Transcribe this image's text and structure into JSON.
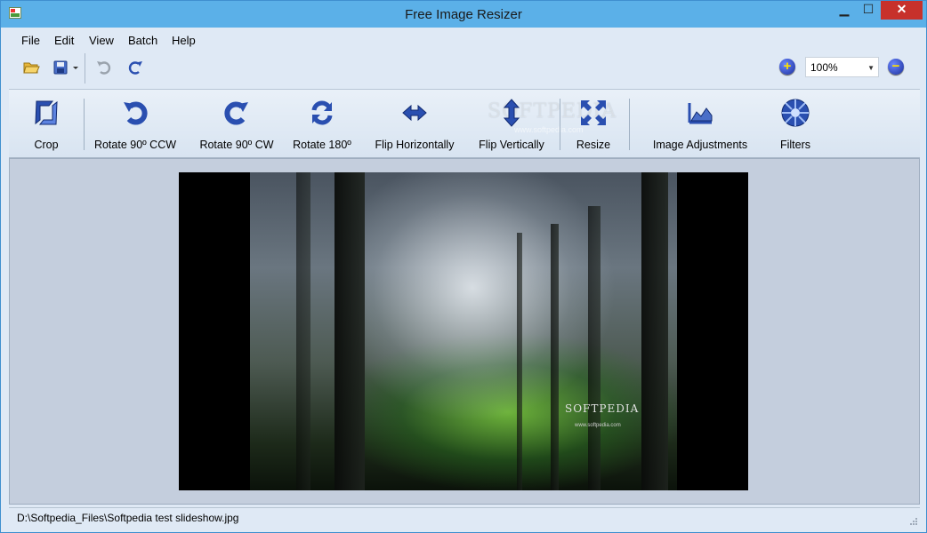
{
  "window": {
    "title": "Free Image Resizer",
    "min_glyph": "▁",
    "max_glyph": "☐",
    "close_glyph": "✕"
  },
  "menu": [
    "File",
    "Edit",
    "View",
    "Batch",
    "Help"
  ],
  "quick": {
    "zoom_value": "100%",
    "zoom_in_glyph": "+",
    "zoom_out_glyph": "−"
  },
  "toolbar": [
    {
      "label": "Crop",
      "icon": "crop-icon"
    },
    {
      "label": "Rotate 90º CCW",
      "icon": "rotate-ccw-icon"
    },
    {
      "label": "Rotate 90º CW",
      "icon": "rotate-cw-icon"
    },
    {
      "label": "Rotate 180º",
      "icon": "rotate-180-icon"
    },
    {
      "label": "Flip Horizontally",
      "icon": "flip-horizontal-icon"
    },
    {
      "label": "Flip Vertically",
      "icon": "flip-vertical-icon"
    },
    {
      "label": "Resize",
      "icon": "resize-icon"
    },
    {
      "label": "Image Adjustments",
      "icon": "image-adjustments-icon"
    },
    {
      "label": "Filters",
      "icon": "filters-icon"
    }
  ],
  "watermark": {
    "text": "SOFTPEDIA",
    "url": "www.softpedia.com"
  },
  "photo": {
    "watermark": "SOFTPEDIA",
    "url": "www.softpedia.com"
  },
  "status": {
    "path": "D:\\Softpedia_Files\\Softpedia test slideshow.jpg"
  },
  "colors": {
    "titlebar": "#5bb0e8",
    "close": "#c7312b",
    "icon_blue": "#2a4fb0"
  }
}
